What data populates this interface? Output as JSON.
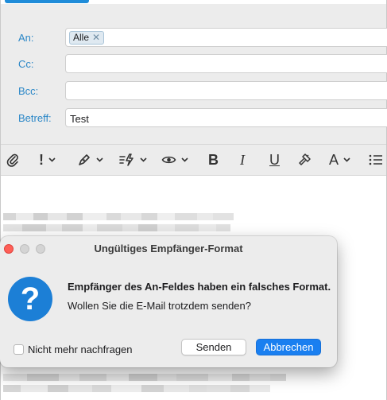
{
  "compose": {
    "fields": [
      {
        "label": "An:",
        "tokens": [
          {
            "text": "Alle",
            "remove": "✕"
          }
        ],
        "value": ""
      },
      {
        "label": "Cc:",
        "tokens": [],
        "value": ""
      },
      {
        "label": "Bcc:",
        "tokens": [],
        "value": ""
      },
      {
        "label": "Betreff:",
        "tokens": [],
        "value": "Test"
      }
    ]
  },
  "toolbar": {
    "items": [
      "attachment-icon",
      "priority-icon",
      "signature-pen-icon",
      "quick-actions-icon",
      "visibility-eye-icon",
      "bold-icon",
      "italic-icon",
      "underline-icon",
      "format-brush-icon",
      "font-color-icon",
      "list-icon"
    ],
    "priority_glyph": "!",
    "bold_glyph": "B",
    "italic_glyph": "I",
    "underline_glyph": "U",
    "font_glyph": "A"
  },
  "dialog": {
    "title": "Ungültiges Empfänger-Format",
    "icon": "question-mark-icon",
    "icon_glyph": "?",
    "message": "Empfänger des An-Feldes haben ein falsches Format.",
    "detail": "Wollen Sie die E-Mail trotzdem senden?",
    "checkbox_label": "Nicht mehr nachfragen",
    "checkbox_checked": false,
    "secondary_button": "Senden",
    "primary_button": "Abbrechen"
  },
  "colors": {
    "label_blue": "#2b87c7",
    "accent": "#1a7ff0",
    "alert_icon": "#1c7fd6",
    "close_red": "#fe5f57"
  }
}
